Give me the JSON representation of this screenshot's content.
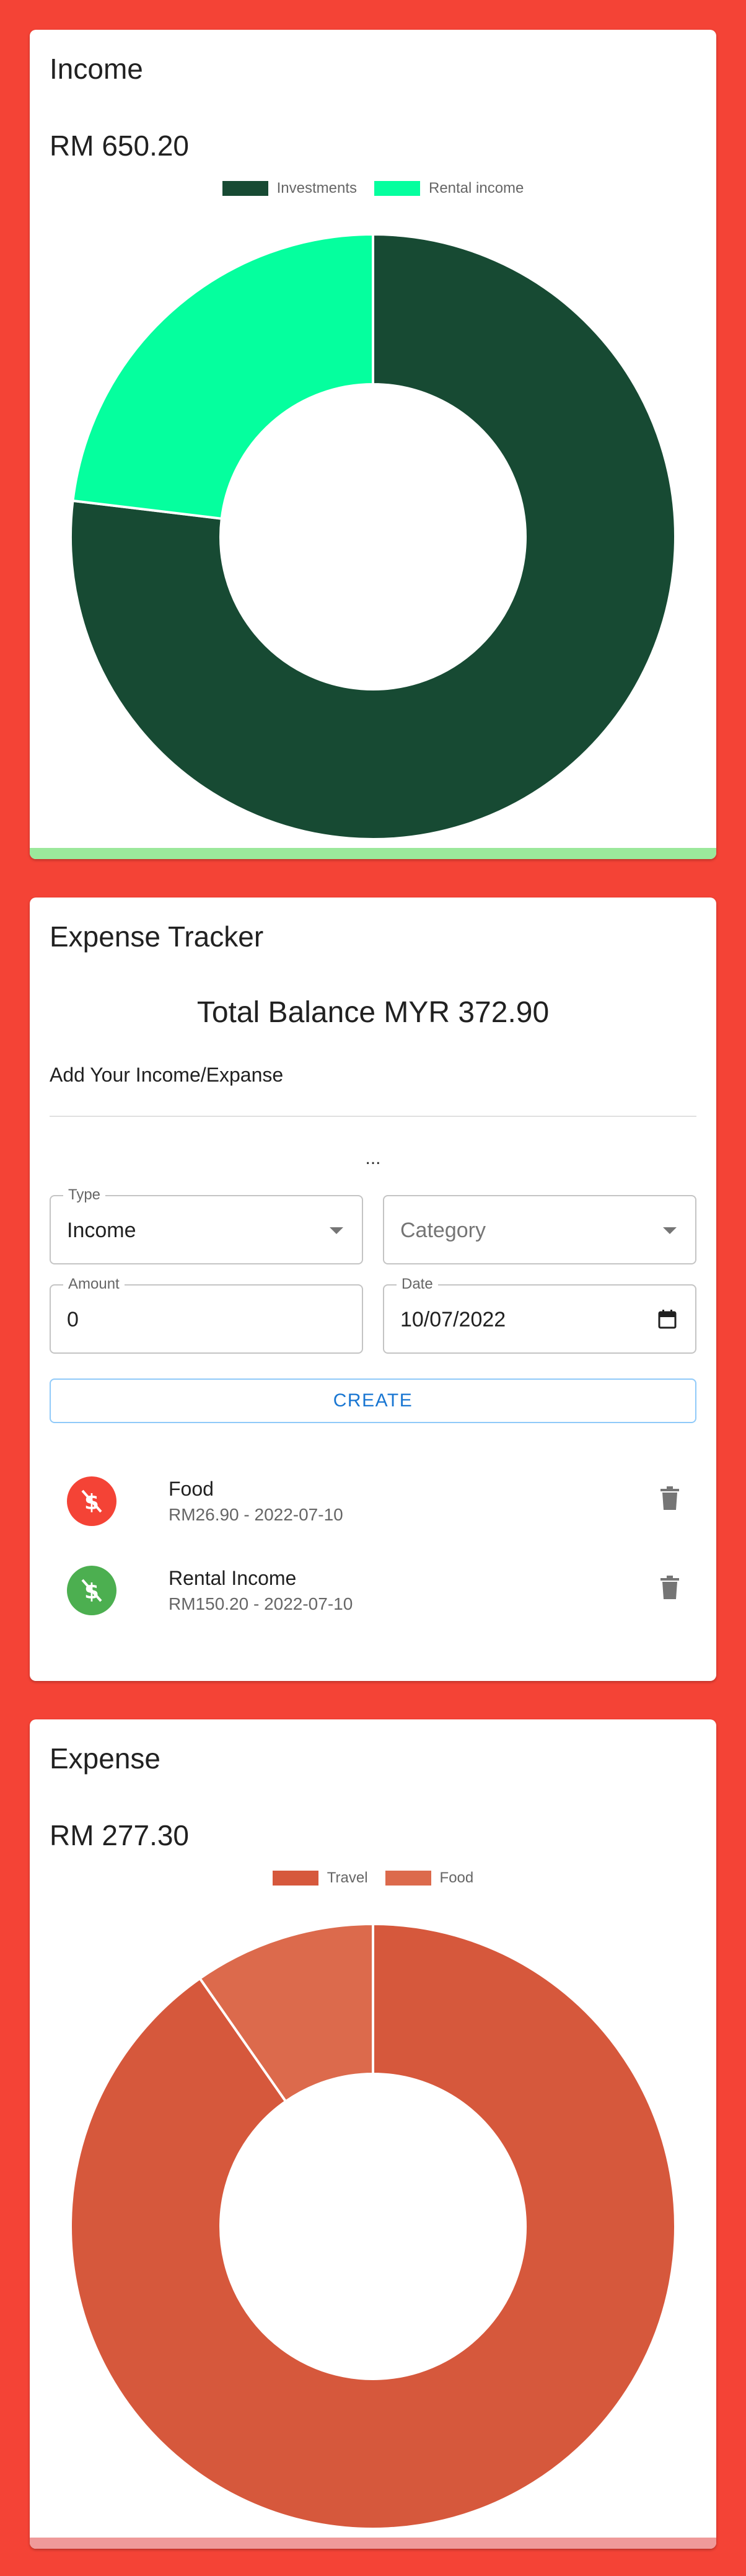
{
  "income_card": {
    "title": "Income",
    "amount": "RM 650.20",
    "accent_bar_color": "#9be89b"
  },
  "tracker": {
    "title": "Expense Tracker",
    "balance": "Total Balance MYR 372.90",
    "subtitle": "Add Your Income/Expanse",
    "ellipsis": "...",
    "form": {
      "type_label": "Type",
      "type_value": "Income",
      "category_placeholder": "Category",
      "amount_label": "Amount",
      "amount_value": "0",
      "date_label": "Date",
      "date_value": "10/07/2022",
      "create_label": "CREATE"
    },
    "transactions": [
      {
        "title": "Food",
        "subtitle": "RM26.90 - 2022-07-10",
        "color": "#f44336",
        "icon": "money-off-icon"
      },
      {
        "title": "Rental Income",
        "subtitle": "RM150.20 - 2022-07-10",
        "color": "#4caf50",
        "icon": "money-off-icon"
      }
    ]
  },
  "expense_card": {
    "title": "Expense",
    "amount": "RM 277.30",
    "accent_bar_color": "#ef9a9a"
  },
  "chart_data": [
    {
      "type": "pie",
      "categories": [
        "Investments",
        "Rental income"
      ],
      "values": [
        500,
        150.2
      ],
      "colors": [
        "#174a33",
        "#05ff9e"
      ],
      "legend": "top"
    },
    {
      "type": "pie",
      "categories": [
        "Travel",
        "Food"
      ],
      "values": [
        250.4,
        26.9
      ],
      "colors": [
        "#d6583c",
        "#dc6a4c"
      ],
      "legend": "top"
    }
  ]
}
